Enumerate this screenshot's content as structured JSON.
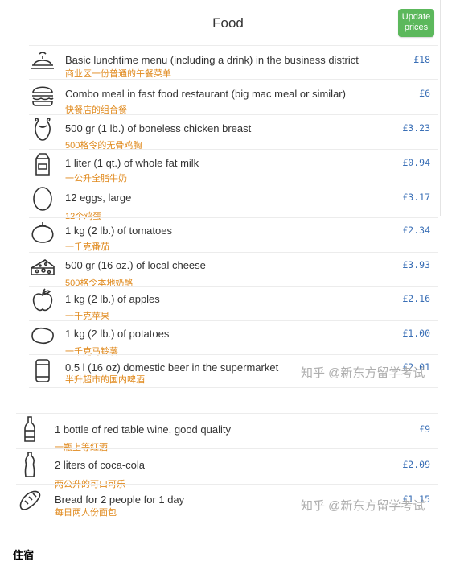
{
  "header": {
    "title": "Food",
    "update_button": "Update prices"
  },
  "items": [
    {
      "icon": "lunch-plate-icon",
      "name": "Basic lunchtime menu (including a drink) in the business district",
      "zh": "商业区一份普通的午餐菜单",
      "price": "£18"
    },
    {
      "icon": "burger-icon",
      "name": "Combo meal in fast food restaurant (big mac meal or similar)",
      "zh": "快餐店的组合餐",
      "price": "£6"
    },
    {
      "icon": "chicken-icon",
      "name": "500 gr (1 lb.) of boneless chicken breast",
      "zh": "500格令的无骨鸡胸",
      "price": "£3.23"
    },
    {
      "icon": "milk-carton-icon",
      "name": "1 liter (1 qt.) of whole fat milk",
      "zh": "一公升全脂牛奶",
      "price": "£0.94"
    },
    {
      "icon": "egg-icon",
      "name": "12 eggs, large",
      "zh": "12个鸡蛋",
      "price": "£3.17"
    },
    {
      "icon": "tomato-icon",
      "name": "1 kg (2 lb.) of tomatoes",
      "zh": "一千克番茄",
      "price": "£2.34"
    },
    {
      "icon": "cheese-icon",
      "name": "500 gr (16 oz.) of local cheese",
      "zh": "500格令本地奶酪",
      "price": "£3.93"
    },
    {
      "icon": "apple-icon",
      "name": "1 kg (2 lb.) of apples",
      "zh": "一千克苹果",
      "price": "£2.16"
    },
    {
      "icon": "potato-icon",
      "name": "1 kg (2 lb.) of potatoes",
      "zh": "一千克马铃薯",
      "price": "£1.00"
    },
    {
      "icon": "beer-can-icon",
      "name": "0.5 l (16 oz) domestic beer in the supermarket",
      "zh": "半升超市的国内啤酒",
      "price": "£2.01"
    }
  ],
  "items2": [
    {
      "icon": "wine-bottle-icon",
      "name": "1 bottle of red table wine, good quality",
      "zh": "一瓶上等红酒",
      "price": "£9"
    },
    {
      "icon": "soda-bottle-icon",
      "name": "2 liters of coca-cola",
      "zh": "两公升的可口可乐",
      "price": "£2.09"
    },
    {
      "icon": "bread-icon",
      "name": "Bread for 2 people for 1 day",
      "zh": "每日两人份面包",
      "price": "£1.15"
    }
  ],
  "watermark": "知乎 @新东方留学考试",
  "section_title": "住宿"
}
